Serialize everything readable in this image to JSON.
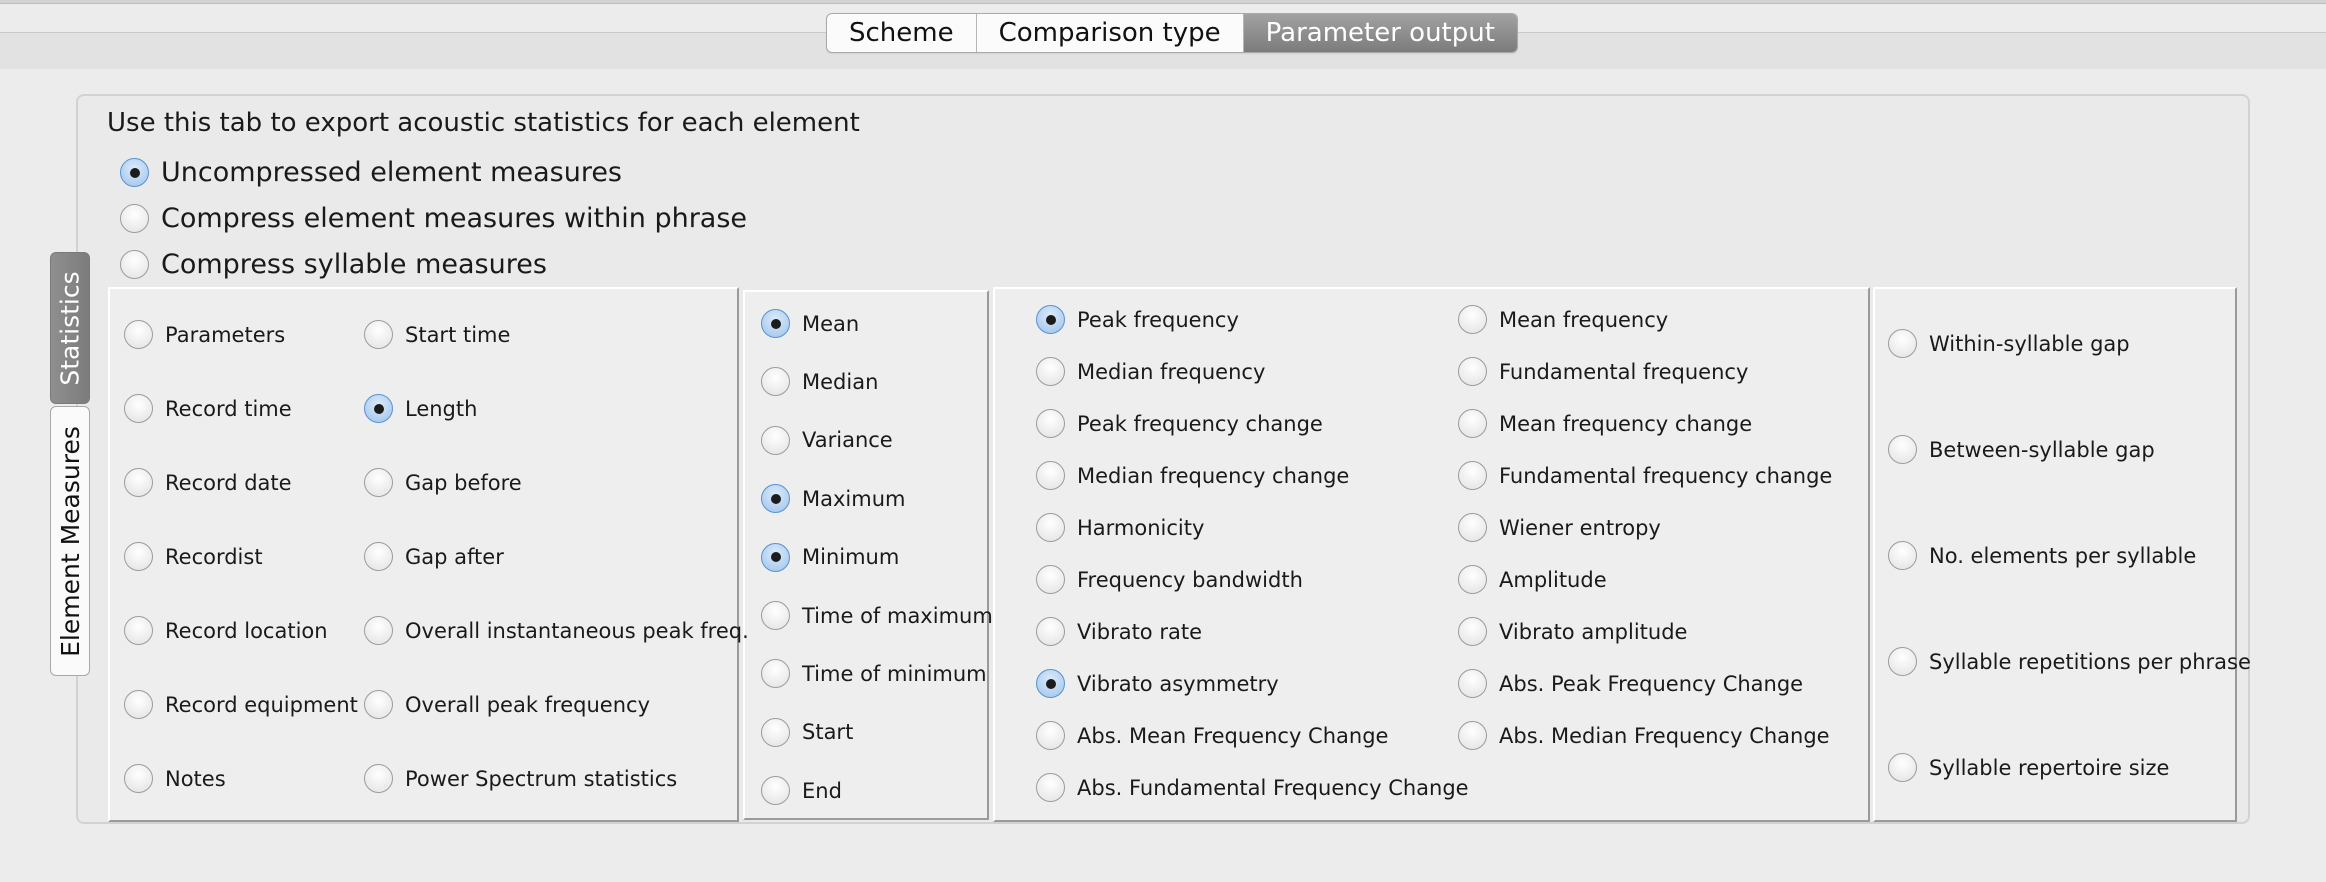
{
  "tabs": [
    {
      "label": "Scheme",
      "active": false
    },
    {
      "label": "Comparison type",
      "active": false
    },
    {
      "label": "Parameter output",
      "active": true
    }
  ],
  "side_tabs": [
    {
      "label": "Statistics",
      "active": true
    },
    {
      "label": "Element Measures",
      "active": false
    }
  ],
  "instructions": "Use this tab to export acoustic statistics for each element",
  "compression_options": [
    {
      "label": "Uncompressed element measures",
      "selected": true
    },
    {
      "label": "Compress element measures within phrase",
      "selected": false
    },
    {
      "label": "Compress syllable measures",
      "selected": false
    }
  ],
  "metadata_col1": [
    {
      "label": "Parameters",
      "selected": false
    },
    {
      "label": "Record time",
      "selected": false
    },
    {
      "label": "Record date",
      "selected": false
    },
    {
      "label": "Recordist",
      "selected": false
    },
    {
      "label": "Record location",
      "selected": false
    },
    {
      "label": "Record equipment",
      "selected": false
    },
    {
      "label": "Notes",
      "selected": false
    }
  ],
  "metadata_col2": [
    {
      "label": "Start time",
      "selected": false
    },
    {
      "label": "Length",
      "selected": true
    },
    {
      "label": "Gap before",
      "selected": false
    },
    {
      "label": "Gap after",
      "selected": false
    },
    {
      "label": "Overall instantaneous peak freq.",
      "selected": false
    },
    {
      "label": "Overall peak frequency",
      "selected": false
    },
    {
      "label": "Power Spectrum statistics",
      "selected": false
    }
  ],
  "statistics": [
    {
      "label": "Mean",
      "selected": true
    },
    {
      "label": "Median",
      "selected": false
    },
    {
      "label": "Variance",
      "selected": false
    },
    {
      "label": "Maximum",
      "selected": true
    },
    {
      "label": "Minimum",
      "selected": true
    },
    {
      "label": "Time of maximum",
      "selected": false
    },
    {
      "label": "Time of minimum",
      "selected": false
    },
    {
      "label": "Start",
      "selected": false
    },
    {
      "label": "End",
      "selected": false
    }
  ],
  "measures_col1": [
    {
      "label": "Peak frequency",
      "selected": true
    },
    {
      "label": "Median frequency",
      "selected": false
    },
    {
      "label": "Peak frequency change",
      "selected": false
    },
    {
      "label": "Median frequency change",
      "selected": false
    },
    {
      "label": "Harmonicity",
      "selected": false
    },
    {
      "label": "Frequency bandwidth",
      "selected": false
    },
    {
      "label": "Vibrato rate",
      "selected": false
    },
    {
      "label": "Vibrato asymmetry",
      "selected": true
    },
    {
      "label": "Abs. Mean Frequency Change",
      "selected": false
    },
    {
      "label": "Abs. Fundamental Frequency Change",
      "selected": false
    }
  ],
  "measures_col2": [
    {
      "label": "Mean frequency",
      "selected": false
    },
    {
      "label": "Fundamental frequency",
      "selected": false
    },
    {
      "label": "Mean frequency change",
      "selected": false
    },
    {
      "label": "Fundamental frequency change",
      "selected": false
    },
    {
      "label": "Wiener entropy",
      "selected": false
    },
    {
      "label": "Amplitude",
      "selected": false
    },
    {
      "label": "Vibrato amplitude",
      "selected": false
    },
    {
      "label": "Abs. Peak Frequency Change",
      "selected": false
    },
    {
      "label": "Abs. Median Frequency Change",
      "selected": false
    }
  ],
  "syllable_measures": [
    {
      "label": "Within-syllable gap",
      "selected": false
    },
    {
      "label": "Between-syllable gap",
      "selected": false
    },
    {
      "label": "No. elements per syllable",
      "selected": false
    },
    {
      "label": "Syllable repetitions per phrase",
      "selected": false
    },
    {
      "label": "Syllable repertoire size",
      "selected": false
    }
  ],
  "colors": {
    "accent_radio": "#9cc2ec",
    "active_tab": "#7c7c7c",
    "panel_bg": "#eaeaea"
  }
}
